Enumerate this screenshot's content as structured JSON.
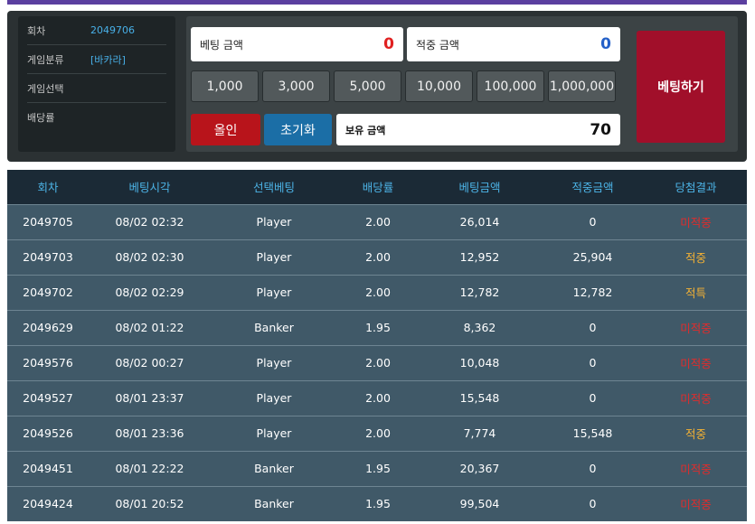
{
  "info": {
    "round_label": "회차",
    "round_value": "2049706",
    "category_label": "게임분류",
    "category_value": "[바카라]",
    "select_label": "게임선택",
    "select_value": "",
    "odds_label": "배당률",
    "odds_value": ""
  },
  "bet": {
    "bet_amount_label": "베팅 금액",
    "bet_amount_value": "0",
    "win_amount_label": "적중 금액",
    "win_amount_value": "0",
    "chips": [
      "1,000",
      "3,000",
      "5,000",
      "10,000",
      "100,000",
      "1,000,000"
    ],
    "allin_label": "올인",
    "reset_label": "초기화",
    "holding_label": "보유 금액",
    "holding_value": "70",
    "bet_button_label": "베팅하기"
  },
  "colors": {
    "accent_red": "#b8141b",
    "accent_blue": "#1b6ea6",
    "header_blue": "#4cb3e6",
    "win_orange": "#f3b134",
    "lose_red": "#e02c2c"
  },
  "history": {
    "headers": [
      "회차",
      "베팅시각",
      "선택베팅",
      "배당률",
      "베팅금액",
      "적중금액",
      "당첨결과"
    ],
    "rows": [
      {
        "round": "2049705",
        "time": "08/02 02:32",
        "pick": "Player",
        "odds": "2.00",
        "bet": "26,014",
        "win": "0",
        "result": "미적중",
        "status": "lose"
      },
      {
        "round": "2049703",
        "time": "08/02 02:30",
        "pick": "Player",
        "odds": "2.00",
        "bet": "12,952",
        "win": "25,904",
        "result": "적중",
        "status": "win"
      },
      {
        "round": "2049702",
        "time": "08/02 02:29",
        "pick": "Player",
        "odds": "2.00",
        "bet": "12,782",
        "win": "12,782",
        "result": "적특",
        "status": "win"
      },
      {
        "round": "2049629",
        "time": "08/02 01:22",
        "pick": "Banker",
        "odds": "1.95",
        "bet": "8,362",
        "win": "0",
        "result": "미적중",
        "status": "lose"
      },
      {
        "round": "2049576",
        "time": "08/02 00:27",
        "pick": "Player",
        "odds": "2.00",
        "bet": "10,048",
        "win": "0",
        "result": "미적중",
        "status": "lose"
      },
      {
        "round": "2049527",
        "time": "08/01 23:37",
        "pick": "Player",
        "odds": "2.00",
        "bet": "15,548",
        "win": "0",
        "result": "미적중",
        "status": "lose"
      },
      {
        "round": "2049526",
        "time": "08/01 23:36",
        "pick": "Player",
        "odds": "2.00",
        "bet": "7,774",
        "win": "15,548",
        "result": "적중",
        "status": "win"
      },
      {
        "round": "2049451",
        "time": "08/01 22:22",
        "pick": "Banker",
        "odds": "1.95",
        "bet": "20,367",
        "win": "0",
        "result": "미적중",
        "status": "lose"
      },
      {
        "round": "2049424",
        "time": "08/01 20:52",
        "pick": "Banker",
        "odds": "1.95",
        "bet": "99,504",
        "win": "0",
        "result": "미적중",
        "status": "lose"
      }
    ]
  }
}
